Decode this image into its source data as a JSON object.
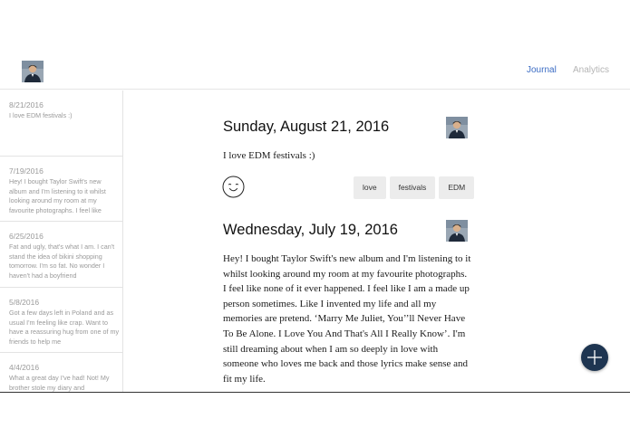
{
  "header": {
    "profile_avatar": "person-photo",
    "nav": {
      "journal": "Journal",
      "analytics": "Analytics"
    },
    "colors": {
      "active": "#3b6cc4",
      "inactive": "#b5b5b5"
    }
  },
  "sidebar": {
    "entries": [
      {
        "date": "8/21/2016",
        "preview": "I love EDM festivals :)"
      },
      {
        "date": "7/19/2016",
        "preview": "Hey! I bought Taylor Swift's new album and I'm listening to it whilst looking around my room at my favourite photographs. I feel like"
      },
      {
        "date": "6/25/2016",
        "preview": "Fat and ugly, that's what I am. I can't stand the idea of bikini shopping tomorrow. I'm so fat. No wonder I haven't had a boyfriend"
      },
      {
        "date": "5/8/2016",
        "preview": "Got a few days left in Poland and as usual I'm feeling like crap. Want to have a reassuring hug from one of my friends to help me"
      },
      {
        "date": "4/4/2016",
        "preview": "What a great day I've had! Not! My brother stole my diary and"
      }
    ]
  },
  "posts": [
    {
      "title": "Sunday, August 21, 2016",
      "body": "I love EDM festivals :)",
      "mood_icon": "smiley-face",
      "tags": [
        "love",
        "festivals",
        "EDM"
      ]
    },
    {
      "title": "Wednesday, July 19, 2016",
      "body": "Hey! I bought Taylor Swift's new album and I'm listening to it whilst looking around my room at my favourite photographs. I feel like none of it ever happened. I feel like I am a made up person sometimes. Like I invented my life and all my memories are pretend. ‘Marry Me Juliet, You’’ll Never Have To Be Alone. I Love You And That's All I Really Know’. I'm still dreaming about when I am so deeply in love with someone who loves me back and those lyrics make sense and fit my life."
    }
  ],
  "fab": {
    "icon": "plus-icon",
    "color": "#1e3551"
  }
}
